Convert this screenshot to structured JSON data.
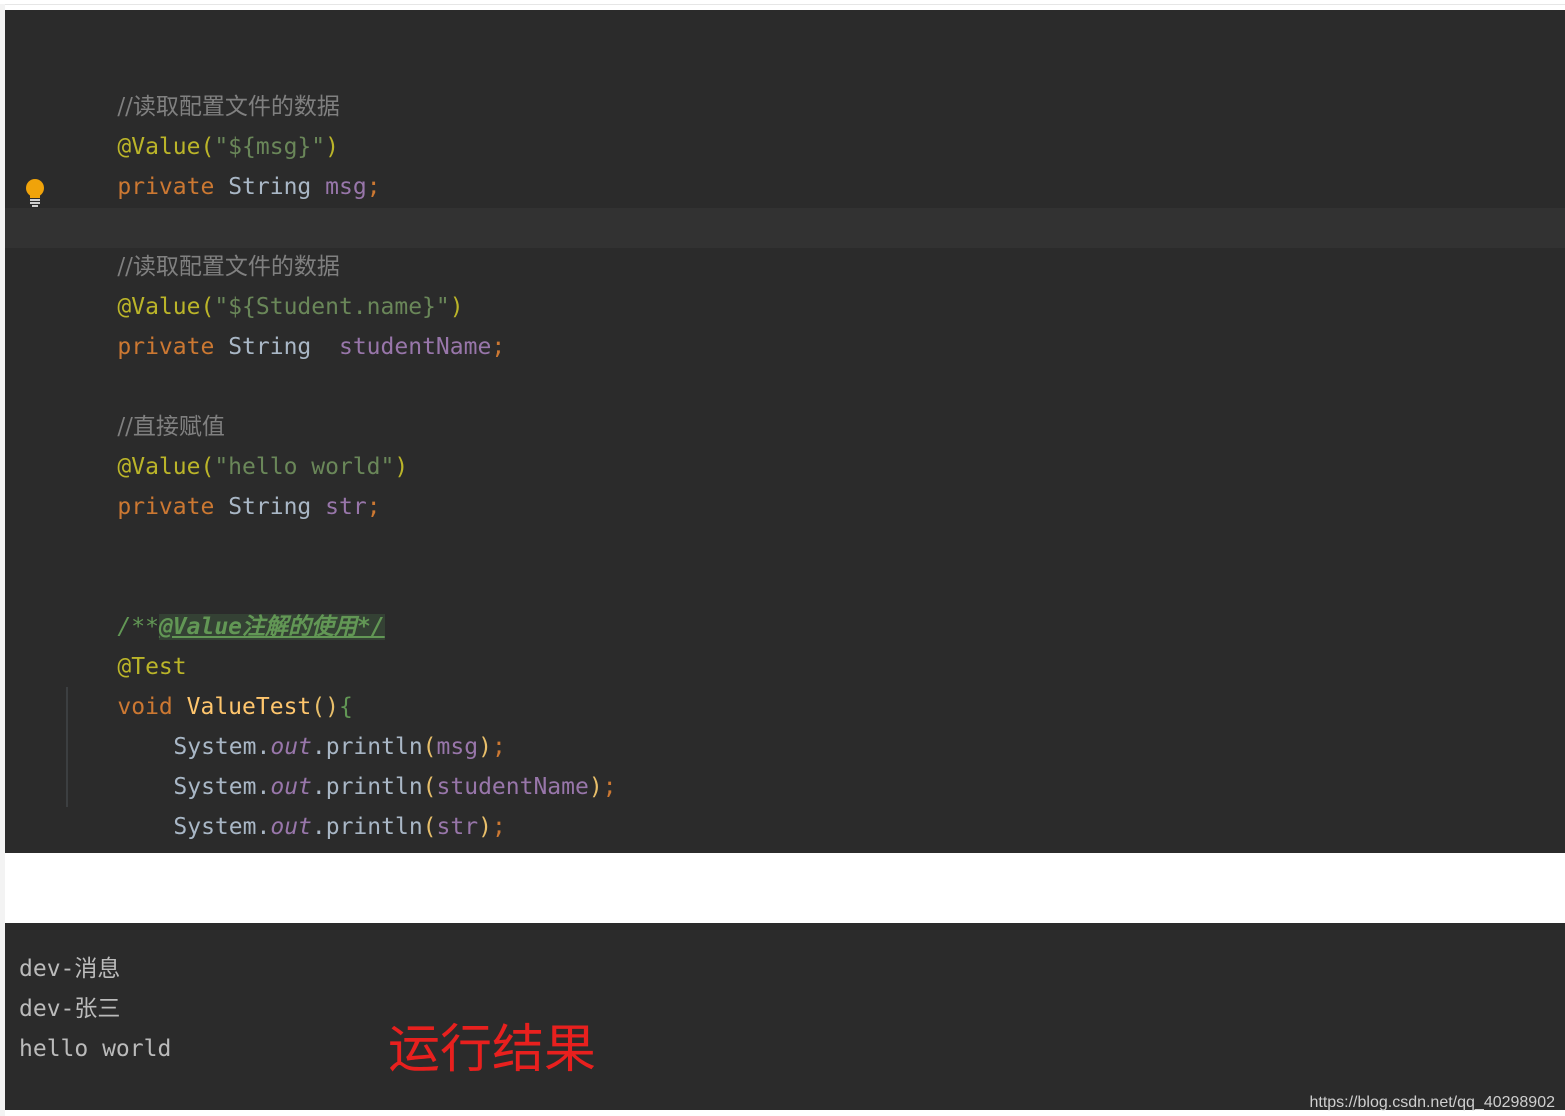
{
  "code_lines": {
    "l1": {
      "comment": "//读取配置文件的数据"
    },
    "l2": {
      "annotation": "@Value(",
      "string": "\"${msg}\"",
      "close": ")"
    },
    "l3": {
      "keyword": "private",
      "type": "String",
      "field": "msg",
      "semi": ";"
    },
    "l5": {
      "comment": "//读取配置文件的数据"
    },
    "l6": {
      "annotation": "@Value(",
      "string": "\"${Student.name}\"",
      "close": ")"
    },
    "l7": {
      "keyword": "private",
      "type": "String",
      "field": "studentName",
      "semi": ";"
    },
    "l9": {
      "comment": "//直接赋值"
    },
    "l10": {
      "annotation": "@Value(",
      "string": "\"hello world\"",
      "close": ")"
    },
    "l11": {
      "keyword": "private",
      "type": "String",
      "field": "str",
      "semi": ";"
    },
    "l14": {
      "doc_open": "/**",
      "doc_text": "@Value注解的使用*/"
    },
    "l15": {
      "annotation": "@Test"
    },
    "l16": {
      "keyword": "void",
      "method": "ValueTest",
      "parens": "()",
      "brace": "{"
    },
    "l17": {
      "cls": "System",
      "dot1": ".",
      "static_field": "out",
      "dot2": ".println",
      "open": "(",
      "arg": "msg",
      "close": ")",
      "semi": ";"
    },
    "l18": {
      "cls": "System",
      "dot1": ".",
      "static_field": "out",
      "dot2": ".println",
      "open": "(",
      "arg": "studentName",
      "close": ")",
      "semi": ";"
    },
    "l19": {
      "cls": "System",
      "dot1": ".",
      "static_field": "out",
      "dot2": ".println",
      "open": "(",
      "arg": "str",
      "close": ")",
      "semi": ";"
    },
    "l20": {
      "brace": "}"
    }
  },
  "console": {
    "lines": [
      "dev-消息",
      "dev-张三",
      "hello world"
    ],
    "caption": "运行结果"
  },
  "watermark": "https://blog.csdn.net/qq_40298902",
  "icons": {
    "intention": "lightbulb-icon"
  },
  "colors": {
    "background": "#2b2b2b",
    "keyword": "#cc7832",
    "annotation": "#bbb529",
    "string": "#6a8759",
    "field": "#9876aa",
    "comment": "#808080",
    "caption": "#e8201e"
  }
}
